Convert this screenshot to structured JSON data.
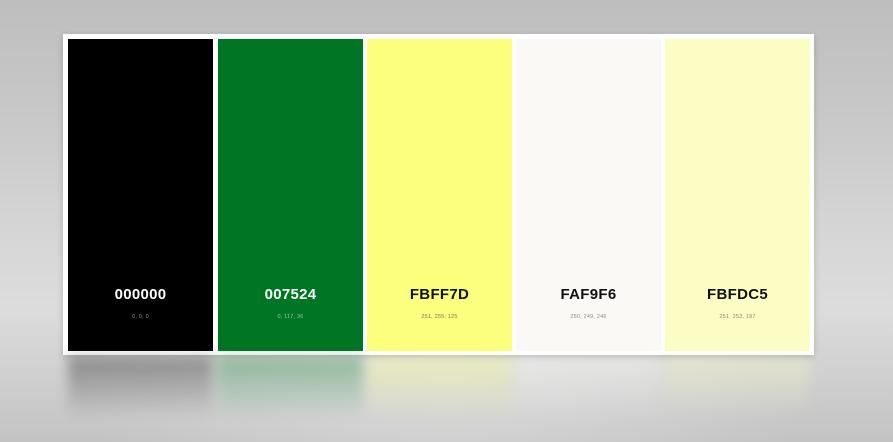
{
  "palette": {
    "swatches": [
      {
        "hex": "000000",
        "rgb": "0, 0, 0",
        "color": "#000000",
        "text_color": "#ffffff",
        "sub_color": "#9a9a9a"
      },
      {
        "hex": "007524",
        "rgb": "0, 117, 36",
        "color": "#007524",
        "text_color": "#ffffff",
        "sub_color": "#9fc9aa"
      },
      {
        "hex": "FBFF7D",
        "rgb": "251, 255, 125",
        "color": "#FBFF7D",
        "text_color": "#111111",
        "sub_color": "#7a7a55"
      },
      {
        "hex": "FAF9F6",
        "rgb": "250, 249, 246",
        "color": "#FAF9F6",
        "text_color": "#111111",
        "sub_color": "#8a8a88"
      },
      {
        "hex": "FBFDC5",
        "rgb": "251, 253, 197",
        "color": "#FBFDC5",
        "text_color": "#111111",
        "sub_color": "#85867a"
      }
    ]
  }
}
